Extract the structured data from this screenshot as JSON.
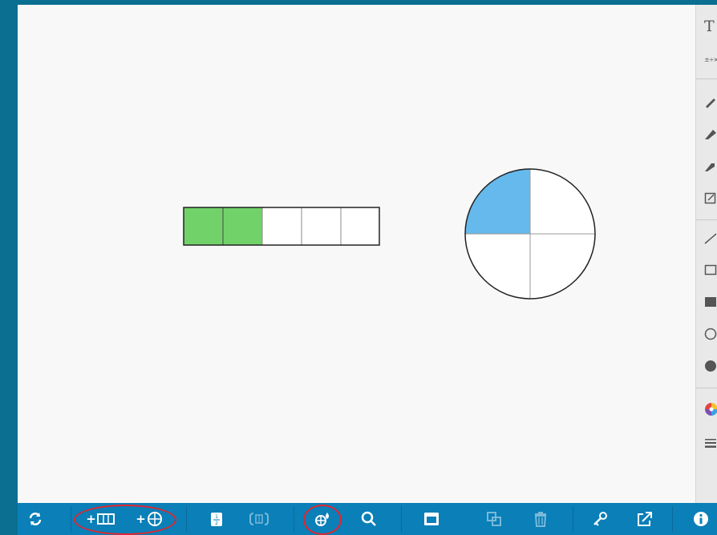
{
  "side_panel": {
    "text_tool_glyph": "T",
    "math_tool_glyph": "±÷×",
    "tools": [
      "pen-icon",
      "marker-icon",
      "highlighter-icon",
      "edit-box-icon",
      "line-icon",
      "rectangle-icon",
      "filled-rectangle-icon",
      "circle-icon",
      "filled-circle-icon",
      "color-picker-icon",
      "line-weight-icon"
    ]
  },
  "workspace": {
    "bar_model": {
      "parts": 5,
      "shaded": 2,
      "shade_color": "#72d26a"
    },
    "circle_model": {
      "parts": 4,
      "shaded": 1,
      "shade_color": "#66b9ec"
    }
  },
  "toolbar": {
    "buttons": [
      "reset-icon",
      "add-bar-icon",
      "add-circle-icon",
      "fraction-label-icon",
      "group-icon",
      "shade-icon",
      "zoom-icon",
      "bring-front-icon",
      "duplicate-icon",
      "delete-icon",
      "key-icon",
      "share-icon",
      "info-icon"
    ],
    "highlight_color": "#e0262e",
    "background": "#0a7fb8"
  }
}
